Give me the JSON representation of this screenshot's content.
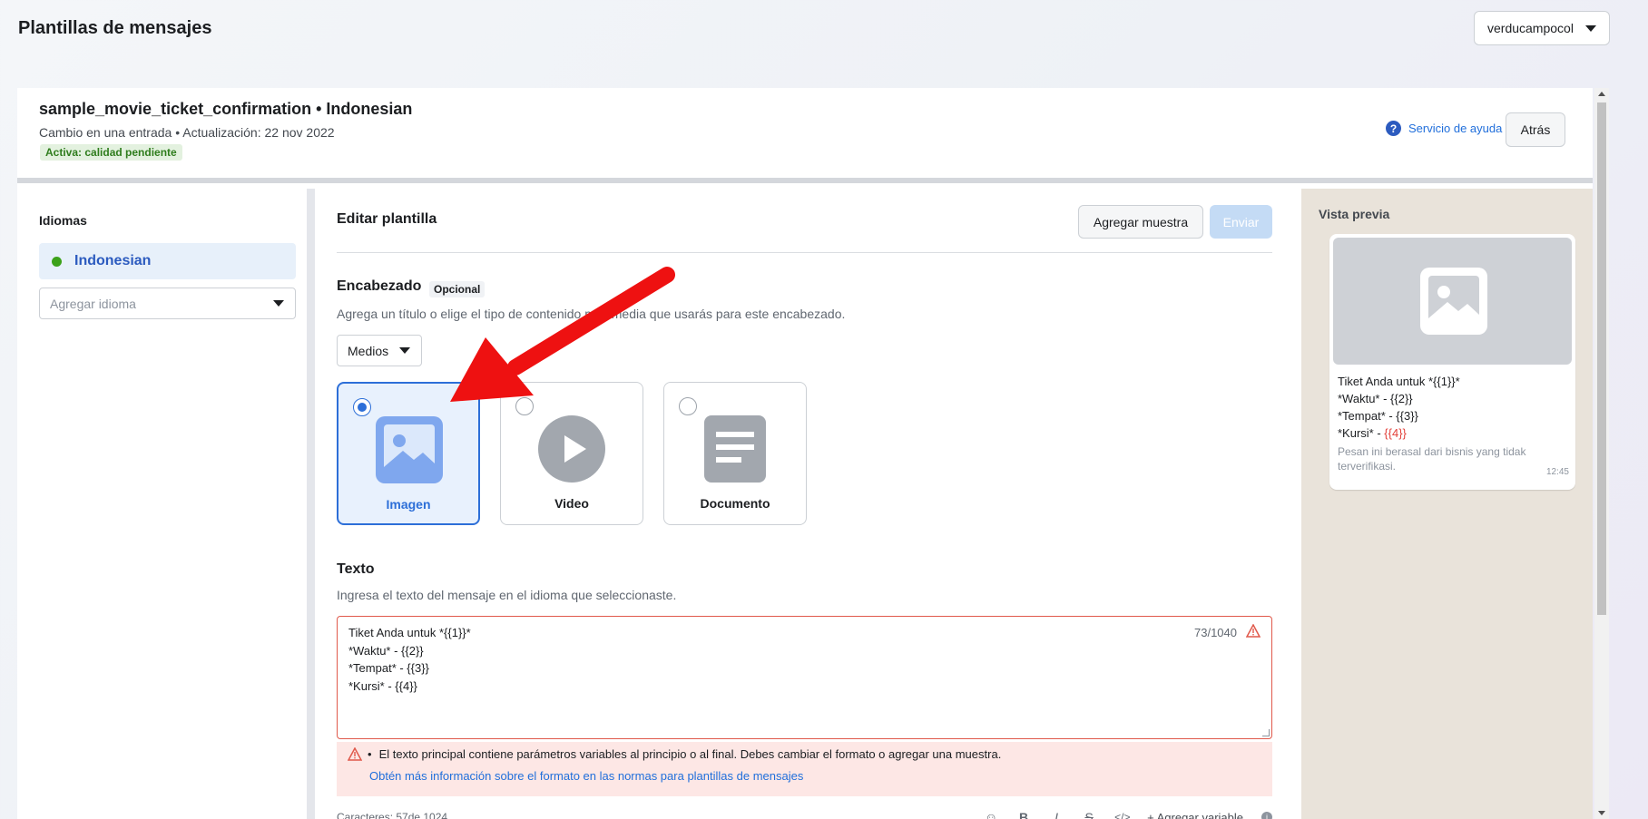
{
  "page": {
    "title": "Plantillas de mensajes"
  },
  "account": {
    "name": "verducampocol"
  },
  "template": {
    "name": "sample_movie_ticket_confirmation • Indonesian",
    "meta": "Cambio en una entrada • Actualización: 22 nov 2022",
    "status": "Activa: calidad pendiente",
    "help_label": "Servicio de ayuda",
    "back_label": "Atrás"
  },
  "languages": {
    "title": "Idiomas",
    "selected": "Indonesian",
    "add_placeholder": "Agregar idioma"
  },
  "editor": {
    "title": "Editar plantilla",
    "add_sample_label": "Agregar muestra",
    "send_label": "Enviar",
    "header": {
      "title": "Encabezado",
      "optional": "Opcional",
      "description": "Agrega un título o elige el tipo de contenido multimedia que usarás para este encabezado.",
      "media_type": "Medios",
      "options": [
        {
          "label": "Imagen",
          "selected": true
        },
        {
          "label": "Video",
          "selected": false
        },
        {
          "label": "Documento",
          "selected": false
        }
      ]
    },
    "body": {
      "title": "Texto",
      "description": "Ingresa el texto del mensaje en el idioma que seleccionaste.",
      "lines": [
        "Tiket Anda untuk *{{1}}*",
        "*Waktu* - {{2}}",
        "*Tempat* - {{3}}",
        "*Kursi* - {{4}}"
      ],
      "char_count": "73/1040",
      "error_message": "El texto principal contiene parámetros variables al principio o al final. Debes cambiar el formato o agregar una muestra.",
      "error_link": "Obtén más información sobre el formato en las normas para plantillas de mensajes",
      "footer_count": "Caracteres: 57de 1024",
      "add_variable_label": "Agregar variable"
    }
  },
  "preview": {
    "title": "Vista previa",
    "lines": [
      "Tiket Anda untuk *{{1}}*",
      "*Waktu* - {{2}}",
      "*Tempat* - {{3}}"
    ],
    "last_line_prefix": "*Kursi* - ",
    "last_line_var": "{{4}}",
    "footer": "Pesan ini berasal dari bisnis yang tidak terverifikasi.",
    "time": "12:45"
  },
  "colors": {
    "accent": "#2d6fd8",
    "error": "#e0594b",
    "status_green": "#2f7d1d",
    "annotation_arrow": "#ee1111"
  },
  "icons": [
    "caret-down-icon",
    "help-icon",
    "image-icon",
    "video-play-icon",
    "document-icon",
    "warning-icon",
    "emoji-icon",
    "bold-icon",
    "italic-icon",
    "strikethrough-icon",
    "code-icon",
    "plus-icon",
    "info-icon"
  ]
}
